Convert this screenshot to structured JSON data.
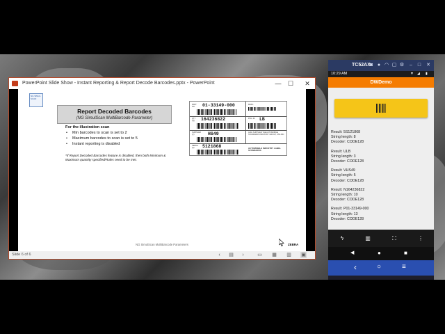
{
  "powerpoint": {
    "window_title": "PowerPoint Slide Show  -  Instant Reporting & Report Decode Barcodes.pptx  -  PowerPoint",
    "controls": {
      "minimize": "—",
      "maximize": "☐",
      "close": "✕"
    },
    "status": {
      "slide_indicator": "Slide 6 of 6"
    },
    "slide": {
      "logo_text": "NG SIMUL SCAN",
      "title": "Report Decoded Barcodes",
      "subtitle": "(NG SimulScan MultiBarcode Parameter)",
      "scan_heading": "For the illustration scan",
      "bullets": [
        "Min barcodes to scan is set to 2",
        "Maximum barcodes to scan is set to 5",
        "Instant reporting is disabled"
      ],
      "note": "*If Report Decoded Barcodes feature is disabled, then both Minimum & Maximum quantity specified/Rules need to be met.",
      "footer": "NG SimulScan MultiBarcode Parameters",
      "brand": "ZEBRA",
      "barcode_label": {
        "code1": "01-33149-000",
        "code2": "164236822",
        "code3": "LB",
        "code4": "HS49",
        "code5": "5121868",
        "supplier": "AIAG SUPPLIER THE AUTOMOBILE STANDARDS INDUSTRY GROUP, USA INC.",
        "footer": "AUTOMOBILE INDUSTRY LABEL STANDARDS"
      }
    }
  },
  "phone": {
    "window_title": "TC52AX",
    "status_time": "10:29 AM",
    "app_title": "DWDemo",
    "scan_button_icon": "barcode-icon",
    "results": [
      {
        "result": "Result: 5S121868",
        "length": "String length: 8",
        "decoder": "Decoder: CODE128"
      },
      {
        "result": "Result: ULB",
        "length": "String length: 3",
        "decoder": "Decoder: CODE128"
      },
      {
        "result": "Result: VHS49",
        "length": "String length: 5",
        "decoder": "Decoder: CODE128"
      },
      {
        "result": "Result: N164236822",
        "length": "String length: 10",
        "decoder": "Decoder: CODE128"
      },
      {
        "result": "Result: P01-33149-000",
        "length": "String length: 13",
        "decoder": "Decoder: CODE128"
      }
    ],
    "toolbar_icons": [
      "flash-icon",
      "barcode-icon",
      "scan-frame-icon",
      "more-icon"
    ],
    "nav_icons": [
      "back-icon",
      "home-icon",
      "recents-icon"
    ],
    "colors": {
      "app_bar": "#f57c00",
      "scan_button": "#f5c518",
      "title_bar": "#2b3a63",
      "nav_bar": "#2a4fb0"
    }
  }
}
